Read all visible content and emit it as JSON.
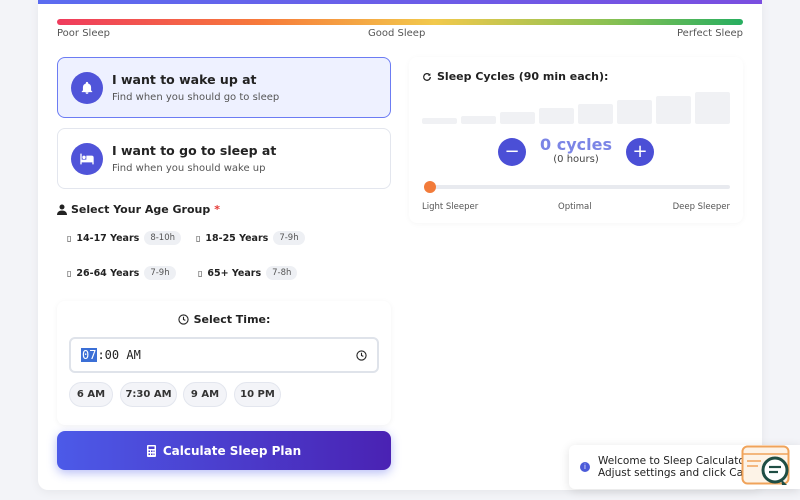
{
  "quality_scale": {
    "labels": [
      "Poor Sleep",
      "Good Sleep",
      "Perfect Sleep"
    ],
    "colors": [
      "#ef3b5d",
      "#f2c94c",
      "#27ae60"
    ]
  },
  "modes": [
    {
      "title": "I want to wake up at",
      "subtitle": "Find when you should go to sleep",
      "icon": "bell-icon",
      "selected": true
    },
    {
      "title": "I want to go to sleep at",
      "subtitle": "Find when you should wake up",
      "icon": "bed-icon",
      "selected": false
    }
  ],
  "age_group": {
    "label": "Select Your Age Group",
    "required_mark": "*",
    "options": [
      {
        "name": "14-17 Years",
        "range": "8-10h"
      },
      {
        "name": "18-25 Years",
        "range": "7-9h"
      },
      {
        "name": "26-64 Years",
        "range": "7-9h"
      },
      {
        "name": "65+ Years",
        "range": "7-8h"
      }
    ],
    "checkbox_glyph": "▯"
  },
  "time": {
    "label": "Select Time:",
    "hour": "07",
    "rest": ":00 AM",
    "presets": [
      "6 AM",
      "7:30 AM",
      "9 AM",
      "10 PM"
    ]
  },
  "calculate_button": "Calculate Sleep Plan",
  "cycles": {
    "title": "Sleep Cycles (90 min each):",
    "count_text": "0 cycles",
    "hours_text": "(0 hours)",
    "minus": "−",
    "plus": "+",
    "slider_labels": [
      "Light Sleeper",
      "Optimal",
      "Deep Sleeper"
    ],
    "slider_value": 0
  },
  "toast": {
    "line1": "Welcome to Sleep Calculator",
    "line2": "Adjust settings and click Calculate",
    "info": "i"
  },
  "accent": "#4b4fd6"
}
